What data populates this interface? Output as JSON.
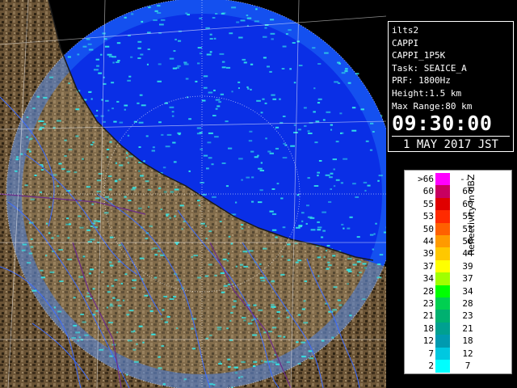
{
  "radar": {
    "station": "ilts2",
    "product": "CAPPI",
    "product_code": "CAPPI_1P5K",
    "task": "Task: SEAICE_A",
    "prf": "PRF: 1800Hz",
    "height": "Height:1.5 km",
    "max_range": "Max Range:80 km",
    "time": "09:30:00",
    "date": "1 MAY 2017 JST"
  },
  "legend": {
    "title": "Reflectivity in dBZ",
    "rows": [
      {
        "lo": ">66",
        "hi": "---",
        "color": "#ff00ff"
      },
      {
        "lo": "60",
        "hi": "66",
        "color": "#c80060"
      },
      {
        "lo": "55",
        "hi": "60",
        "color": "#e00000"
      },
      {
        "lo": "53",
        "hi": "55",
        "color": "#ff2a00"
      },
      {
        "lo": "50",
        "hi": "53",
        "color": "#ff6000"
      },
      {
        "lo": "44",
        "hi": "50",
        "color": "#ff9a00"
      },
      {
        "lo": "39",
        "hi": "44",
        "color": "#ffc800"
      },
      {
        "lo": "37",
        "hi": "39",
        "color": "#ffff00"
      },
      {
        "lo": "34",
        "hi": "37",
        "color": "#a0ff00"
      },
      {
        "lo": "28",
        "hi": "34",
        "color": "#00ff00"
      },
      {
        "lo": "23",
        "hi": "28",
        "color": "#00d050"
      },
      {
        "lo": "21",
        "hi": "23",
        "color": "#00b070"
      },
      {
        "lo": "18",
        "hi": "21",
        "color": "#00a090"
      },
      {
        "lo": "12",
        "hi": "18",
        "color": "#009ab0"
      },
      {
        "lo": "7",
        "hi": "12",
        "color": "#00c8e0"
      },
      {
        "lo": "2",
        "hi": "7",
        "color": "#00ffff"
      }
    ]
  },
  "colors": {
    "sea": "#0a2fe6",
    "sea_range": "#1e6cf5",
    "land": "#6b5436",
    "land_dark": "#3e2f1c",
    "echo": "#33e6e6",
    "river": "#3c6cff"
  }
}
